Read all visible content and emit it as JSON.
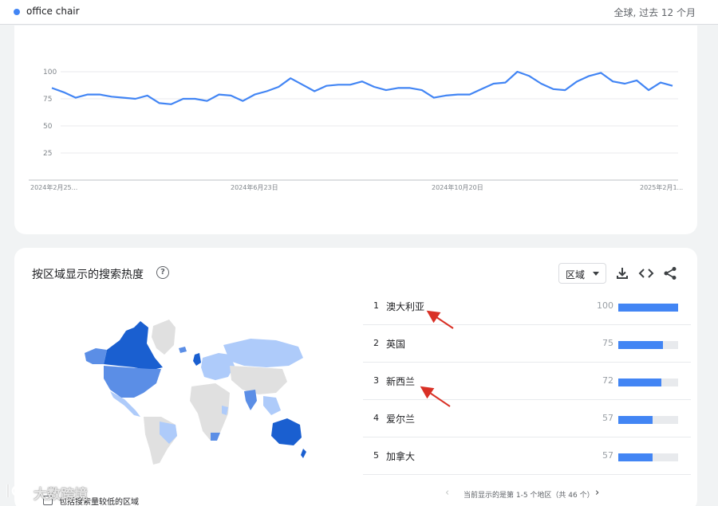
{
  "topbar": {
    "term": "office chair",
    "scope": "全球, 过去 12 个月"
  },
  "trend": {
    "yticks": [
      "100",
      "75",
      "50",
      "25"
    ],
    "xticks": [
      "2024年2月25...",
      "2024年6月23日",
      "2024年10月20日",
      "2025年2月1..."
    ]
  },
  "chart_data": {
    "type": "line",
    "title": "",
    "xlabel": "",
    "ylabel": "",
    "ylim": [
      0,
      100
    ],
    "grid": true,
    "series": [
      {
        "values": [
          85,
          81,
          76,
          79,
          79,
          77,
          76,
          75,
          78,
          71,
          70,
          75,
          75,
          73,
          79,
          78,
          73,
          79,
          82,
          86,
          94,
          88,
          82,
          87,
          88,
          88,
          91,
          86,
          83,
          85,
          85,
          83,
          76,
          78,
          79,
          79,
          84,
          89,
          90,
          100,
          96,
          89,
          84,
          83,
          91,
          96,
          99,
          91,
          89,
          92,
          83,
          90,
          87
        ]
      }
    ],
    "color": "#4285f4"
  },
  "region": {
    "title": "按区域显示的搜索热度",
    "help_icon": "help-circle-icon",
    "select_label": "区域",
    "tools": {
      "download": "download-icon",
      "embed": "code-icon",
      "share": "share-icon"
    },
    "ranks": [
      {
        "num": "1",
        "name": "澳大利亚",
        "value": "100",
        "fraction": 1.0
      },
      {
        "num": "2",
        "name": "英国",
        "value": "75",
        "fraction": 0.75
      },
      {
        "num": "3",
        "name": "新西兰",
        "value": "72",
        "fraction": 0.72
      },
      {
        "num": "4",
        "name": "爱尔兰",
        "value": "57",
        "fraction": 0.57
      },
      {
        "num": "5",
        "name": "加拿大",
        "value": "57",
        "fraction": 0.57
      }
    ],
    "pager": {
      "text": "当前显示的是第 1-5 个地区（共 46 个）",
      "prev": "‹",
      "next": "›"
    },
    "low_volume_label": "包括搜索量较低的区域"
  },
  "colors": {
    "accent": "#4285f4",
    "map_high": "#1a5fd0",
    "map_mid": "#5b8ee6",
    "map_low": "#aecbfa",
    "map_none": "#e0e0e0",
    "arrow": "#d93025"
  },
  "watermark": {
    "text": "大数跨境"
  }
}
